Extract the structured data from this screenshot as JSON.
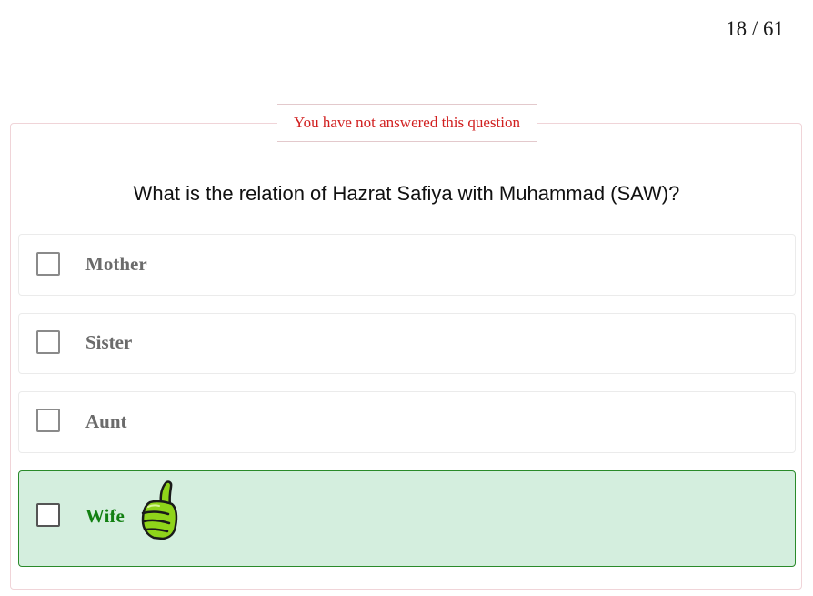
{
  "progress": {
    "current": 18,
    "total": 61,
    "text": "18 / 61"
  },
  "status": {
    "text": "You have not answered this question"
  },
  "question": {
    "text": "What is the relation of Hazrat Safiya with Muhammad (SAW)?"
  },
  "options": [
    {
      "label": "Mother",
      "checked": false,
      "correct": false
    },
    {
      "label": "Sister",
      "checked": false,
      "correct": false
    },
    {
      "label": "Aunt",
      "checked": false,
      "correct": false
    },
    {
      "label": "Wife",
      "checked": false,
      "correct": true,
      "icon": "thumbs-up-icon"
    }
  ],
  "colors": {
    "status_text": "#d12020",
    "correct_bg": "#d4eede",
    "correct_border": "#2a8a2a",
    "correct_text": "#128012",
    "option_text": "#6b6b6b"
  }
}
